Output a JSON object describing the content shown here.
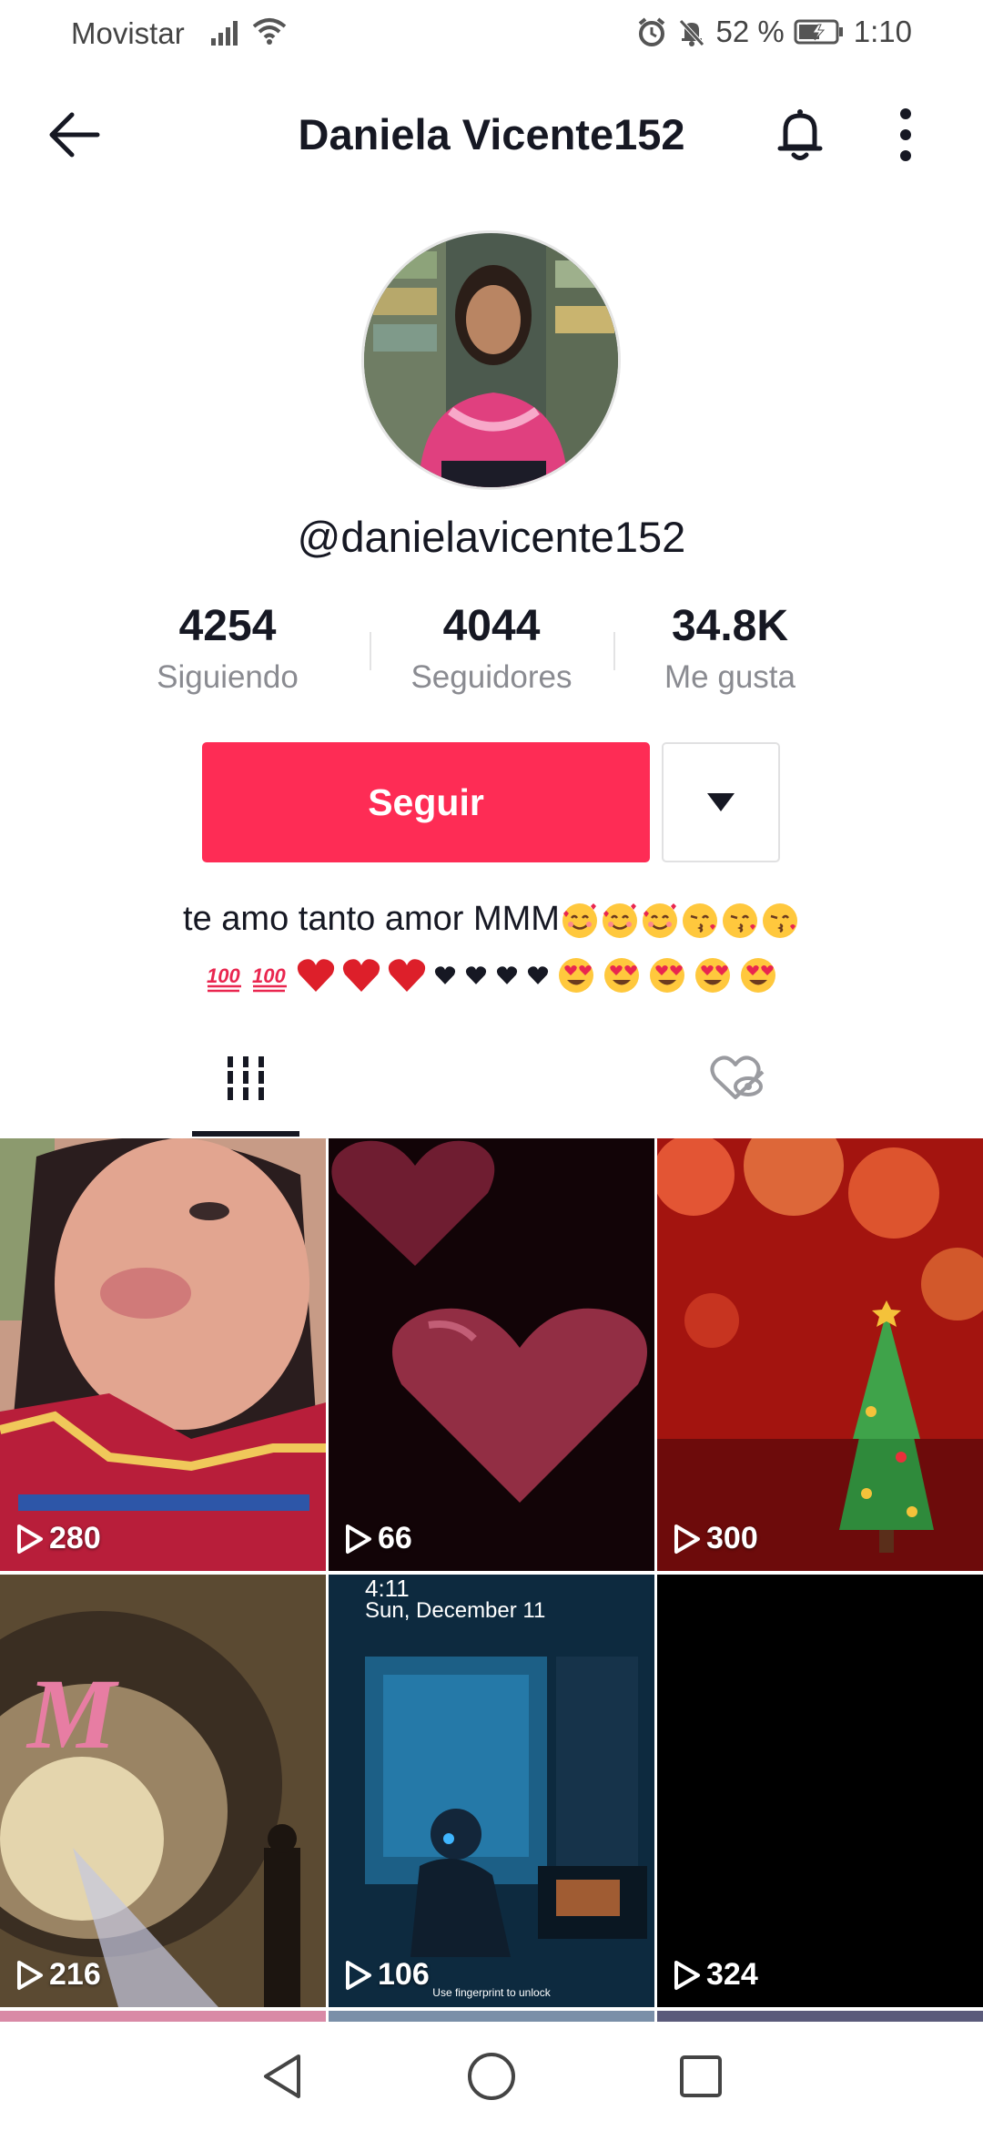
{
  "status_bar": {
    "carrier": "Movistar",
    "battery": "52 %",
    "time": "1:10"
  },
  "header": {
    "title": "Daniela Vicente152"
  },
  "profile": {
    "username": "@danielavicente152",
    "stats": [
      {
        "value": "4254",
        "label": "Siguiendo"
      },
      {
        "value": "4044",
        "label": "Seguidores"
      },
      {
        "value": "34.8K",
        "label": "Me gusta"
      }
    ],
    "follow_label": "Seguir",
    "bio_text": "te amo tanto amor MMM"
  },
  "tabs": [
    {
      "icon": "grid-videos-icon",
      "active": true
    },
    {
      "icon": "liked-hidden-icon",
      "active": false
    }
  ],
  "videos": [
    {
      "views": "280"
    },
    {
      "views": "66"
    },
    {
      "views": "300"
    },
    {
      "views": "216"
    },
    {
      "views": "106",
      "overlay_time": "4:11",
      "overlay_date": "Sun, December 11",
      "overlay_hint": "Use fingerprint to unlock"
    },
    {
      "views": "324"
    }
  ],
  "colors": {
    "accent": "#fe2c55",
    "text_primary": "#161823",
    "text_secondary": "#8a8b91"
  }
}
